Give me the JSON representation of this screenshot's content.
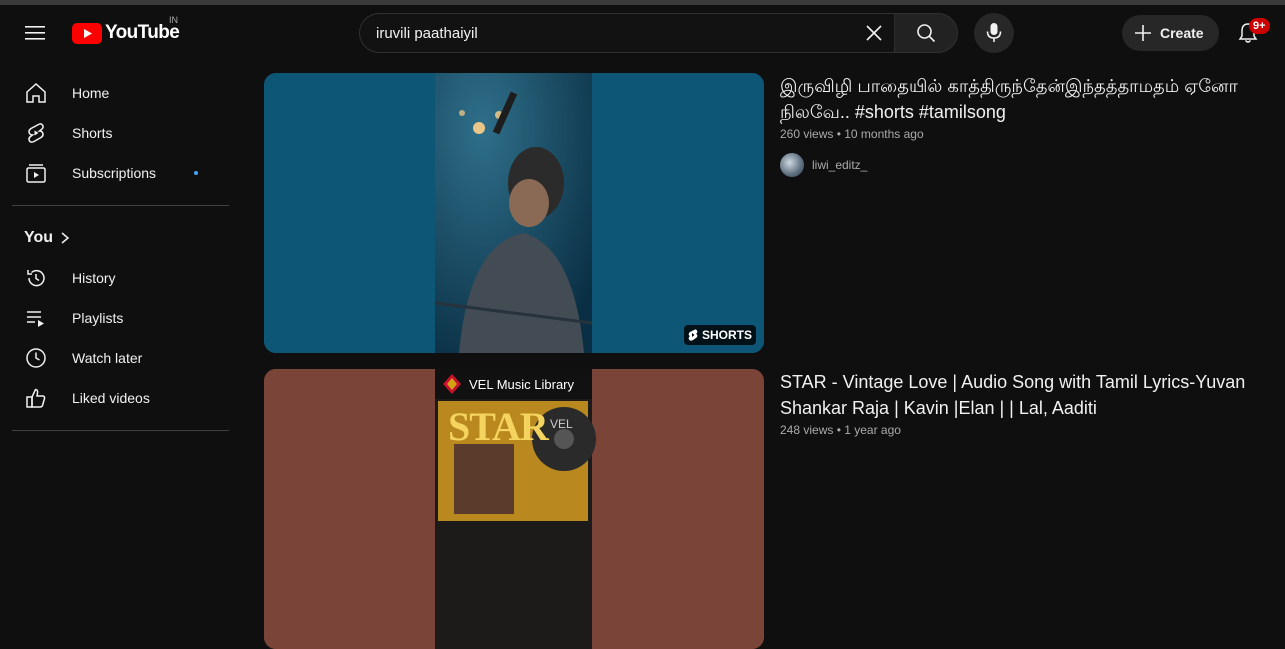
{
  "header": {
    "logo_text": "YouTube",
    "country_code": "IN",
    "search_value": "iruvili paathaiyil",
    "create_label": "Create",
    "notifications_badge": "9+"
  },
  "sidebar": {
    "items": [
      {
        "label": "Home",
        "icon": "home-icon"
      },
      {
        "label": "Shorts",
        "icon": "shorts-icon"
      },
      {
        "label": "Subscriptions",
        "icon": "subscriptions-icon"
      }
    ],
    "you_label": "You",
    "you_items": [
      {
        "label": "History",
        "icon": "history-icon"
      },
      {
        "label": "Playlists",
        "icon": "playlists-icon"
      },
      {
        "label": "Watch later",
        "icon": "watch-later-icon"
      },
      {
        "label": "Liked videos",
        "icon": "liked-videos-icon"
      }
    ]
  },
  "results": [
    {
      "title": "இருவிழி பாதையில் காத்திருந்தேன்இந்தத்தாமதம் ஏனோ நிலவே.. #shorts #tamilsong",
      "meta": "260 views • 10 months ago",
      "channel": "liwi_editz_",
      "badge": "SHORTS"
    },
    {
      "title": "STAR - Vintage Love | Audio Song with Tamil Lyrics-Yuvan Shankar Raja | Kavin |Elan | | Lal, Aaditi",
      "meta": "248 views • 1 year ago",
      "thumb_banner": "VEL Music Library",
      "thumb_logo": "STAR",
      "thumb_disc": "VEL"
    }
  ],
  "colors": {
    "accent_red": "#ff0000",
    "subscription_dot": "#3ea6ff",
    "thumb1_bg": "#0e5676",
    "thumb2_bg": "#7a4538"
  }
}
